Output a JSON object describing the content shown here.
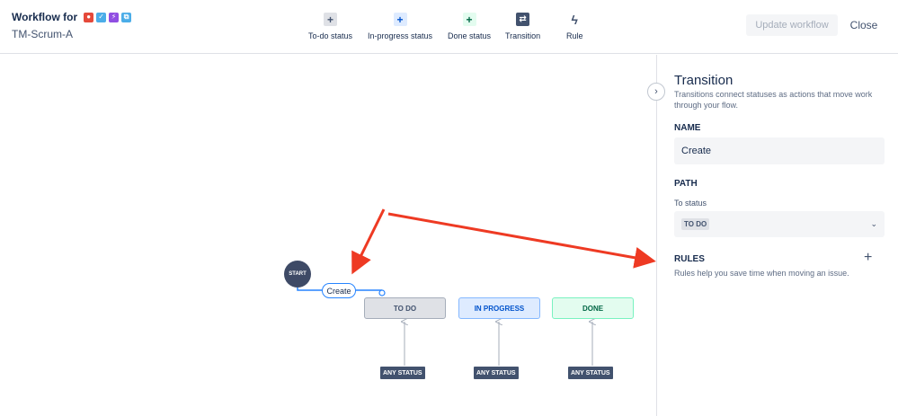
{
  "header": {
    "title": "Workflow for",
    "subtitle": "TM-Scrum-A",
    "issue_type_icons": [
      {
        "name": "bug-type-icon",
        "color": "#e5493a",
        "glyph": "●"
      },
      {
        "name": "task-type-icon",
        "color": "#4bade8",
        "glyph": "✓"
      },
      {
        "name": "epic-type-icon",
        "color": "#904ee2",
        "glyph": "⚡"
      },
      {
        "name": "subtask-type-icon",
        "color": "#4bade8",
        "glyph": "⧉"
      }
    ],
    "update_label": "Update workflow",
    "close_label": "Close"
  },
  "toolbar": [
    {
      "name": "todo-status-tool",
      "icon": "+",
      "icon_name": "plus-icon",
      "bg": "#dfe1e6",
      "fg": "#42526e",
      "label": "To-do status"
    },
    {
      "name": "inprogress-status-tool",
      "icon": "+",
      "icon_name": "plus-icon",
      "bg": "#deebff",
      "fg": "#0052cc",
      "label": "In-progress status"
    },
    {
      "name": "done-status-tool",
      "icon": "+",
      "icon_name": "plus-icon",
      "bg": "#e3fcef",
      "fg": "#006644",
      "label": "Done status"
    },
    {
      "name": "transition-tool",
      "icon": "⇄",
      "icon_name": "transition-icon",
      "bg": "#42526e",
      "fg": "#ffffff",
      "label": "Transition"
    },
    {
      "name": "rule-tool",
      "icon": "ϟ",
      "icon_name": "lightning-icon",
      "bg": "transparent",
      "fg": "#42526e",
      "label": "Rule"
    }
  ],
  "diagram": {
    "start_label": "START",
    "transition_label": "Create",
    "statuses": [
      {
        "label": "TO DO",
        "bg": "#dfe1e6",
        "border": "#a5adba",
        "color": "#42526e"
      },
      {
        "label": "IN PROGRESS",
        "bg": "#deebff",
        "border": "#85b8ff",
        "color": "#0052cc"
      },
      {
        "label": "DONE",
        "bg": "#e3fcef",
        "border": "#79f2c0",
        "color": "#006644"
      }
    ],
    "any_status_label": "ANY STATUS"
  },
  "panel": {
    "title": "Transition",
    "description": "Transitions connect statuses as actions that move work through your flow.",
    "name_label": "NAME",
    "name_value": "Create",
    "path_label": "PATH",
    "to_status_label": "To status",
    "to_status_value": "TO DO",
    "rules_label": "RULES",
    "rules_description": "Rules help you save time when moving an issue."
  },
  "accent_color": "#2684ff",
  "annotation_arrow_color": "#ee3a23"
}
